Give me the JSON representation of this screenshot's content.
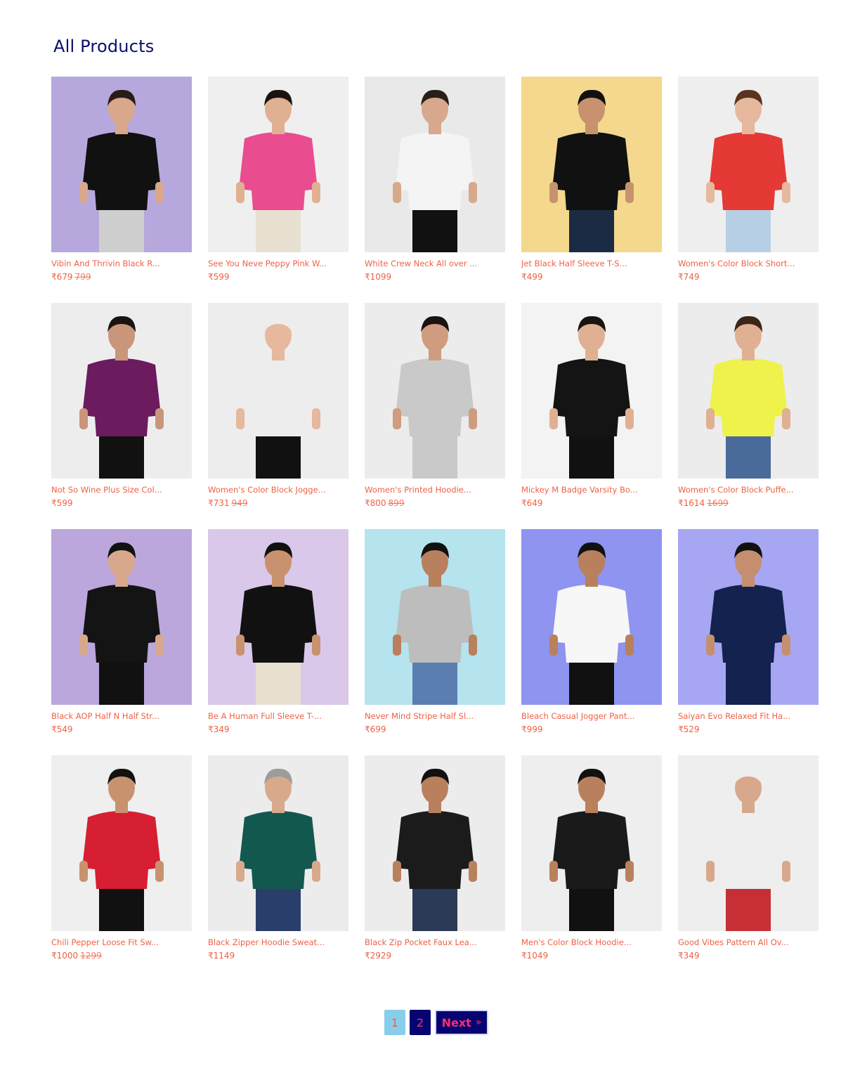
{
  "page": {
    "title": "All Products"
  },
  "products": [
    {
      "name": "Vibin And Thrivin Black R...",
      "price": "₹679",
      "old_price": "799",
      "bg": "#b6a8dc",
      "shirt": "#111111",
      "pants": "#cfcfcf",
      "skin": "#d9a78c",
      "hair": "#2b1b16"
    },
    {
      "name": "See You Neve Peppy Pink W...",
      "price": "₹599",
      "old_price": "",
      "bg": "#efefef",
      "shirt": "#e94d8f",
      "pants": "#e8e0d0",
      "skin": "#e0b092",
      "hair": "#1a1410"
    },
    {
      "name": "White Crew Neck All over ...",
      "price": "₹1099",
      "old_price": "",
      "bg": "#e9e9e9",
      "shirt": "#f4f4f4",
      "pants": "#111111",
      "skin": "#d8a88c",
      "hair": "#2a1f18"
    },
    {
      "name": "Jet Black Half Sleeve T-S...",
      "price": "₹499",
      "old_price": "",
      "bg": "#f4d88e",
      "shirt": "#111111",
      "pants": "#1b2b44",
      "skin": "#c8926e",
      "hair": "#111111"
    },
    {
      "name": "Women's Color Block Short...",
      "price": "₹749",
      "old_price": "",
      "bg": "#eeeeee",
      "shirt": "#e53935",
      "pants": "#b7cfe4",
      "skin": "#e6b89d",
      "hair": "#5a341f"
    },
    {
      "name": "Not So Wine Plus Size Col...",
      "price": "₹599",
      "old_price": "",
      "bg": "#ededed",
      "shirt": "#6b1b5e",
      "pants": "#111111",
      "skin": "#c9957b",
      "hair": "#1a1410"
    },
    {
      "name": "Women's Color Block Jogge...",
      "price": "₹731",
      "old_price": "949",
      "bg": "#ededed",
      "shirt": "#ededed",
      "pants": "#111111",
      "skin": "#e6b89d",
      "hair": "#ededed"
    },
    {
      "name": "Women's Printed Hoodie...",
      "price": "₹800",
      "old_price": "899",
      "bg": "#ececec",
      "shirt": "#c9c9c9",
      "pants": "#c9c9c9",
      "skin": "#cf9c80",
      "hair": "#1a1410"
    },
    {
      "name": "Mickey M Badge Varsity Bo...",
      "price": "₹649",
      "old_price": "",
      "bg": "#f3f3f3",
      "shirt": "#141414",
      "pants": "#111111",
      "skin": "#e0b092",
      "hair": "#1a1410"
    },
    {
      "name": "Women's Color Block Puffe...",
      "price": "₹1614",
      "old_price": "1699",
      "bg": "#ececec",
      "shirt": "#eef24a",
      "pants": "#4a6a9a",
      "skin": "#e0b092",
      "hair": "#3a2618"
    },
    {
      "name": "Black AOP Half N Half Str...",
      "price": "₹549",
      "old_price": "",
      "bg": "#bba7dc",
      "shirt": "#141414",
      "pants": "#111111",
      "skin": "#d8a88c",
      "hair": "#111111"
    },
    {
      "name": "Be A Human Full Sleeve T-...",
      "price": "₹349",
      "old_price": "",
      "bg": "#d9c8ea",
      "shirt": "#111111",
      "pants": "#e8e0cf",
      "skin": "#c8926e",
      "hair": "#111111"
    },
    {
      "name": "Never Mind Stripe Half Sl...",
      "price": "₹699",
      "old_price": "",
      "bg": "#b5e3ee",
      "shirt": "#bdbdbd",
      "pants": "#5b7eb1",
      "skin": "#b9805e",
      "hair": "#111111"
    },
    {
      "name": "Bleach Casual Jogger Pant...",
      "price": "₹999",
      "old_price": "",
      "bg": "#8e94ef",
      "shirt": "#f7f7f7",
      "pants": "#111111",
      "skin": "#b9805e",
      "hair": "#111111"
    },
    {
      "name": "Saiyan Evo Relaxed Fit Ha...",
      "price": "₹529",
      "old_price": "",
      "bg": "#a7a6f3",
      "shirt": "#13224f",
      "pants": "#13224f",
      "skin": "#c58e6f",
      "hair": "#111111"
    },
    {
      "name": "Chili Pepper Loose Fit Sw...",
      "price": "₹1000",
      "old_price": "1299",
      "bg": "#efefef",
      "shirt": "#d61f33",
      "pants": "#111111",
      "skin": "#c8926e",
      "hair": "#111111"
    },
    {
      "name": "Black Zipper Hoodie Sweat...",
      "price": "₹1149",
      "old_price": "",
      "bg": "#ececec",
      "shirt": "#13584f",
      "pants": "#2a3e6b",
      "skin": "#d9a98c",
      "hair": "#9c9c9c"
    },
    {
      "name": "Black Zip Pocket Faux Lea...",
      "price": "₹2929",
      "old_price": "",
      "bg": "#ececec",
      "shirt": "#1b1b1b",
      "pants": "#2d3a55",
      "skin": "#b9805e",
      "hair": "#111111"
    },
    {
      "name": "Men's Color Block Hoodie...",
      "price": "₹1049",
      "old_price": "",
      "bg": "#eeeeee",
      "shirt": "#1a1a1a",
      "pants": "#111111",
      "skin": "#b9805e",
      "hair": "#111111"
    },
    {
      "name": "Good Vibes Pattern All Ov...",
      "price": "₹349",
      "old_price": "",
      "bg": "#eeeeee",
      "shirt": "#eeeeee",
      "pants": "#c62f33",
      "skin": "#d8a88c",
      "hair": "#eeeeee"
    }
  ],
  "pagination": {
    "pages": [
      "1",
      "2"
    ],
    "active": "1",
    "next_label": "Next",
    "next_icon": "»"
  }
}
